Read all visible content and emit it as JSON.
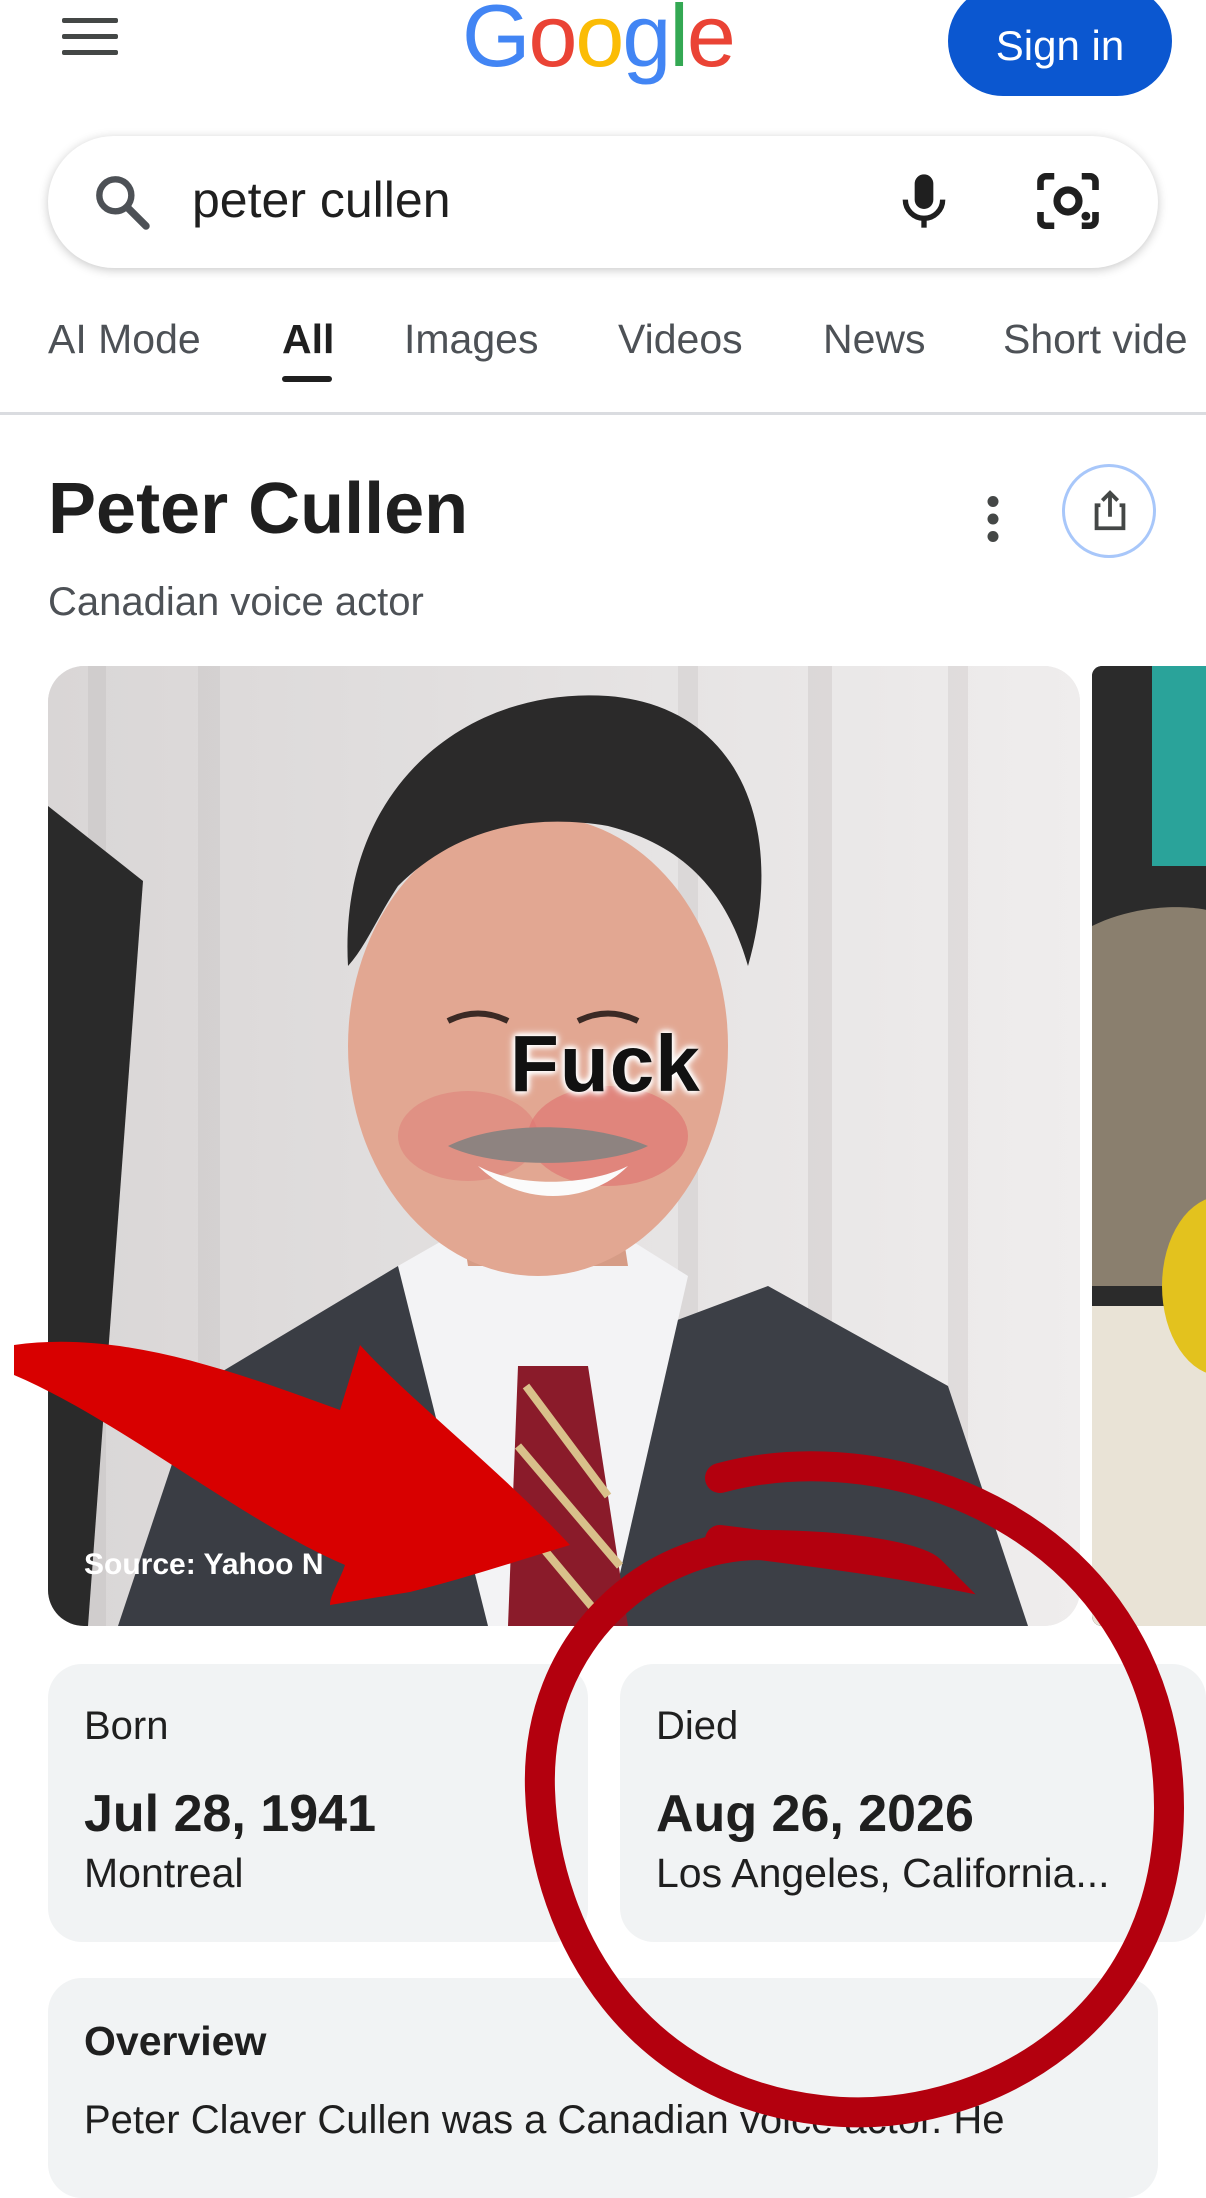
{
  "header": {
    "logo_letters": [
      "G",
      "o",
      "o",
      "g",
      "l",
      "e"
    ],
    "logo_colors": [
      "#4285f4",
      "#ea4335",
      "#fbbc05",
      "#4285f4",
      "#34a853",
      "#ea4335"
    ],
    "sign_in_label": "Sign in"
  },
  "search": {
    "query": "peter cullen"
  },
  "tabs": [
    {
      "label": "AI Mode",
      "active": false
    },
    {
      "label": "All",
      "active": true
    },
    {
      "label": "Images",
      "active": false
    },
    {
      "label": "Videos",
      "active": false
    },
    {
      "label": "News",
      "active": false
    },
    {
      "label": "Short vide",
      "active": false
    }
  ],
  "entity": {
    "name": "Peter Cullen",
    "description": "Canadian voice actor",
    "image_source": "Source: Yahoo N",
    "overlay_text": "Fuck"
  },
  "facts": {
    "born_label": "Born",
    "born_date": "Jul 28, 1941",
    "born_place": "Montreal",
    "died_label": "Died",
    "died_date": "Aug 26, 2026",
    "died_place": "Los Angeles, California..."
  },
  "overview": {
    "heading": "Overview",
    "text": "Peter Claver Cullen was a Canadian voice actor. He"
  },
  "colors": {
    "accent": "#0b57d0",
    "annotation_red": "#d80000",
    "circle_red": "#b3000e"
  }
}
